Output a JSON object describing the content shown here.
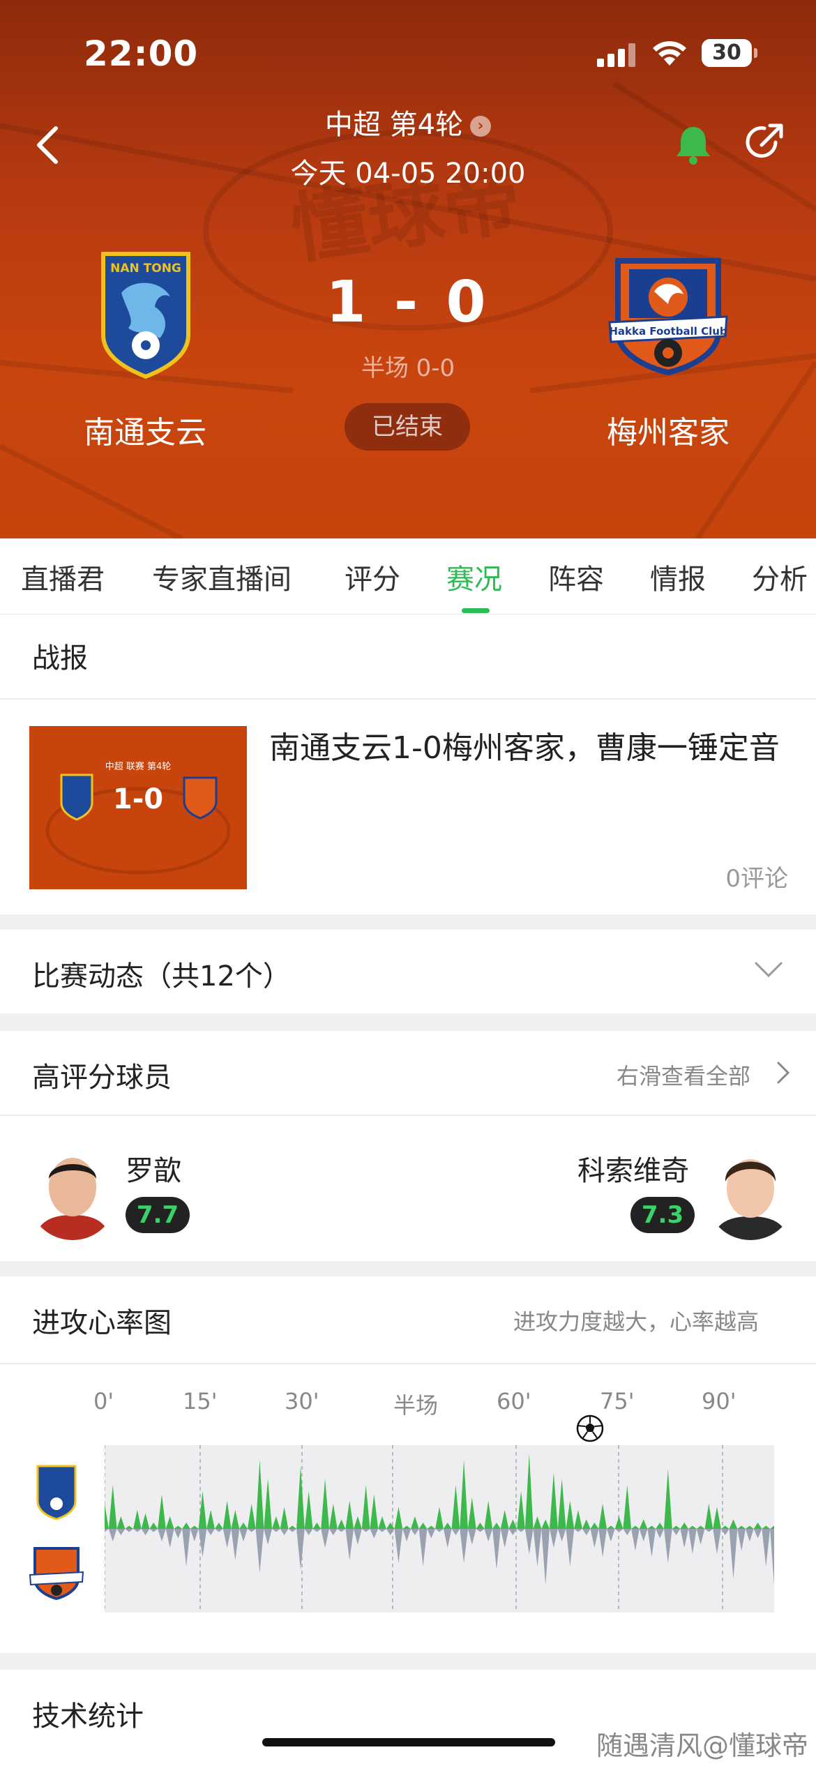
{
  "status_bar": {
    "time": "22:00",
    "battery": "30"
  },
  "header": {
    "league_round": "中超 第4轮",
    "datetime": "今天 04-05 20:00",
    "home_team": "南通支云",
    "away_team": "梅州客家",
    "score": "1 - 0",
    "half_time": "半场 0-0",
    "match_status": "已结束",
    "home_logo_text": "NAN TONG",
    "away_logo_text": "Hakka Football Club",
    "watermark": "懂球帝"
  },
  "tabs": [
    "直播君",
    "专家直播间",
    "评分",
    "赛况",
    "阵容",
    "情报",
    "分析"
  ],
  "active_tab": "赛况",
  "report": {
    "section_title": "战报",
    "headline": "南通支云1-0梅州客家，曹康一锤定音",
    "comments": "0评论",
    "thumb_round": "中超 联赛 第4轮",
    "thumb_score": "1-0"
  },
  "events": {
    "title": "比赛动态（共12个）"
  },
  "top_players": {
    "title": "高评分球员",
    "link": "右滑查看全部",
    "home": {
      "name": "罗歆",
      "rating": "7.7"
    },
    "away": {
      "name": "科索维奇",
      "rating": "7.3"
    }
  },
  "heartbeat": {
    "title": "进攻心率图",
    "subtitle": "进攻力度越大，心率越高",
    "minutes": [
      "0'",
      "15'",
      "30'",
      "半场",
      "60'",
      "75'",
      "90'"
    ],
    "colors": {
      "home": "#3cb94a",
      "away": "#9aa1b0"
    }
  },
  "tech_stats": {
    "title": "技术统计"
  },
  "watermark_footer": "随遇清风@懂球帝"
}
